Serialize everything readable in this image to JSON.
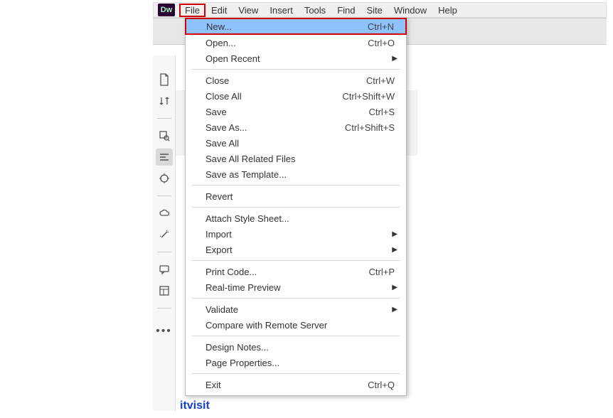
{
  "app_logo_text": "Dw",
  "menubar": {
    "file": "File",
    "edit": "Edit",
    "view": "View",
    "insert": "Insert",
    "tools": "Tools",
    "find": "Find",
    "site": "Site",
    "window": "Window",
    "help": "Help"
  },
  "file_menu": {
    "new": "New...",
    "new_sc": "Ctrl+N",
    "open": "Open...",
    "open_sc": "Ctrl+O",
    "open_recent": "Open Recent",
    "close": "Close",
    "close_sc": "Ctrl+W",
    "close_all": "Close All",
    "close_all_sc": "Ctrl+Shift+W",
    "save": "Save",
    "save_sc": "Ctrl+S",
    "save_as": "Save As...",
    "save_as_sc": "Ctrl+Shift+S",
    "save_all": "Save All",
    "save_related": "Save All Related Files",
    "save_template": "Save as Template...",
    "revert": "Revert",
    "attach_css": "Attach Style Sheet...",
    "import": "Import",
    "export": "Export",
    "print_code": "Print Code...",
    "print_code_sc": "Ctrl+P",
    "rt_preview": "Real-time Preview",
    "validate": "Validate",
    "compare_remote": "Compare with Remote Server",
    "design_notes": "Design Notes...",
    "page_props": "Page Properties...",
    "exit": "Exit",
    "exit_sc": "Ctrl+Q"
  },
  "document_text": "itvisit",
  "arrow_glyph": "▶",
  "more_dots": "•••"
}
